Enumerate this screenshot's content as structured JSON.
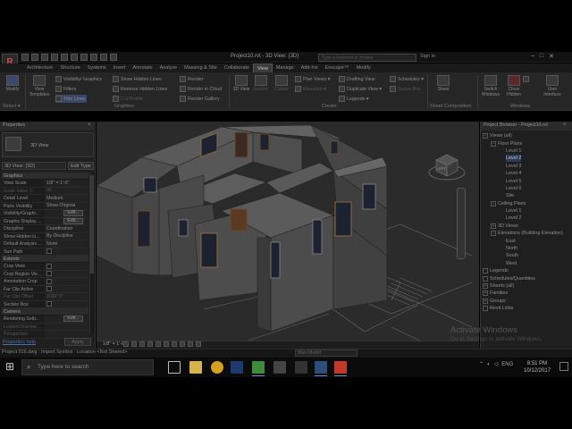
{
  "titlebar": {
    "app_logo": "R",
    "doc_title": "Project10.rvt - 3D View: {3D}",
    "search_placeholder": "Type a keyword or phrase",
    "signin": "Sign In",
    "win_min": "–",
    "win_max": "□",
    "win_close": "✕"
  },
  "tabs": [
    {
      "label": "Architecture"
    },
    {
      "label": "Structure"
    },
    {
      "label": "Systems"
    },
    {
      "label": "Insert"
    },
    {
      "label": "Annotate"
    },
    {
      "label": "Analyze"
    },
    {
      "label": "Massing & Site"
    },
    {
      "label": "Collaborate"
    },
    {
      "label": "View"
    },
    {
      "label": "Manage"
    },
    {
      "label": "Add-Ins"
    },
    {
      "label": "Enscape™"
    },
    {
      "label": "Modify"
    }
  ],
  "ribbon": {
    "modify": "Modify",
    "select": "Select ▾",
    "view_templates": "View Templates",
    "visibility_graphics": "Visibility/ Graphics",
    "filters": "Filters",
    "thin_lines": "Thin Lines",
    "show_hidden_lines": "Show Hidden Lines",
    "remove_hidden_lines": "Remove Hidden Lines",
    "cut_profile": "Cut Profile",
    "render": "Render",
    "render_in_cloud": "Render in Cloud",
    "render_gallery": "Render Gallery",
    "graphics": "Graphics",
    "view_3d": "3D View",
    "section": "Section",
    "callout": "Callout",
    "plan_views": "Plan Views ▾",
    "elevation": "Elevation ▾",
    "drafting_view": "Drafting View",
    "duplicate_view": "Duplicate View ▾",
    "legends": "Legends ▾",
    "schedules": "Schedules ▾",
    "scope_box": "Scope Box",
    "create": "Create",
    "sheet": "Sheet",
    "sheet_composition": "Sheet Composition",
    "switch_windows": "Switch Windows",
    "close_hidden": "Close Hidden",
    "replicate": "Replicate",
    "user_interface": "User Interface",
    "windows": "Windows"
  },
  "properties": {
    "header": "Properties",
    "close": "×",
    "type_name": "3D View",
    "view_dropdown": "3D View: {3D}",
    "edit_type": "Edit Type",
    "groups": {
      "graphics": "Graphics",
      "extents": "Extents",
      "camera": "Camera"
    },
    "rows_graphics": [
      {
        "key": "View Scale",
        "value": "1/8\" = 1'-0\""
      },
      {
        "key": "Scale Value  1:",
        "value": "96"
      },
      {
        "key": "Detail Level",
        "value": "Medium"
      },
      {
        "key": "Parts Visibility",
        "value": "Show Original"
      },
      {
        "key": "Visibility/Graphi...",
        "value": "Edit..."
      },
      {
        "key": "Graphic Display ...",
        "value": "Edit..."
      },
      {
        "key": "Discipline",
        "value": "Coordination"
      },
      {
        "key": "Show Hidden Li...",
        "value": "By Discipline"
      },
      {
        "key": "Default Analysis ...",
        "value": "None"
      },
      {
        "key": "Sun Path",
        "value": ""
      }
    ],
    "rows_extents": [
      {
        "key": "Crop View",
        "value": ""
      },
      {
        "key": "Crop Region Vis...",
        "value": ""
      },
      {
        "key": "Annotation Crop",
        "value": ""
      },
      {
        "key": "Far Clip Active",
        "value": ""
      },
      {
        "key": "Far Clip Offset",
        "value": "1000' 0\""
      },
      {
        "key": "Section Box",
        "value": ""
      }
    ],
    "rows_camera": [
      {
        "key": "Rendering Setti...",
        "value": "Edit..."
      },
      {
        "key": "Locked Orientat...",
        "value": ""
      },
      {
        "key": "Perspective",
        "value": ""
      }
    ],
    "help_link": "Properties help",
    "apply": "Apply"
  },
  "view": {
    "scale": "1/8\" = 1'-0\"",
    "cube_label": "LEFT"
  },
  "browser": {
    "header": "Project Browser - Project10.rvt",
    "close": "×",
    "tree": [
      {
        "label": "Views (all)",
        "level": 0,
        "toggle": "−"
      },
      {
        "label": "Floor Plans",
        "level": 1,
        "toggle": "−"
      },
      {
        "label": "Level 1",
        "level": 2
      },
      {
        "label": "Level 2",
        "level": 2,
        "selected": true
      },
      {
        "label": "Level 3",
        "level": 2
      },
      {
        "label": "Level 4",
        "level": 2
      },
      {
        "label": "Level 5",
        "level": 2
      },
      {
        "label": "Level 6",
        "level": 2
      },
      {
        "label": "Site",
        "level": 2
      },
      {
        "label": "Ceiling Plans",
        "level": 1,
        "toggle": "−"
      },
      {
        "label": "Level 1",
        "level": 2
      },
      {
        "label": "Level 2",
        "level": 2
      },
      {
        "label": "3D Views",
        "level": 1,
        "toggle": "+"
      },
      {
        "label": "Elevations (Building Elevation)",
        "level": 1,
        "toggle": "−"
      },
      {
        "label": "East",
        "level": 2
      },
      {
        "label": "North",
        "level": 2
      },
      {
        "label": "South",
        "level": 2
      },
      {
        "label": "West",
        "level": 2
      },
      {
        "label": "Legends",
        "level": 0,
        "toggle": ""
      },
      {
        "label": "Schedules/Quantities",
        "level": 0,
        "toggle": ""
      },
      {
        "label": "Sheets (all)",
        "level": 0,
        "toggle": "+"
      },
      {
        "label": "Families",
        "level": 0,
        "toggle": "+"
      },
      {
        "label": "Groups",
        "level": 0,
        "toggle": "+"
      },
      {
        "label": "Revit Links",
        "level": 0,
        "toggle": ""
      }
    ]
  },
  "statusbar": {
    "text": "Project 016.dwg : Import Symbol : Location <Not Shared>",
    "main_model": "Main Model",
    "watermark_title": "Activate Windows",
    "watermark_sub": "Go to Settings to activate Windows."
  },
  "taskbar": {
    "start": "⊞",
    "search_placeholder": "Type here to search",
    "search_icon": "search-icon",
    "tray_lang": "ENG",
    "time": "8:51 PM",
    "date": "10/12/2017",
    "colors": {
      "revit_red": "#c0392b",
      "chrome": "#d4a020",
      "photoshop": "#1c3a6e",
      "camtasia": "#3c8c3c",
      "explorer": "#d6b24c"
    }
  }
}
